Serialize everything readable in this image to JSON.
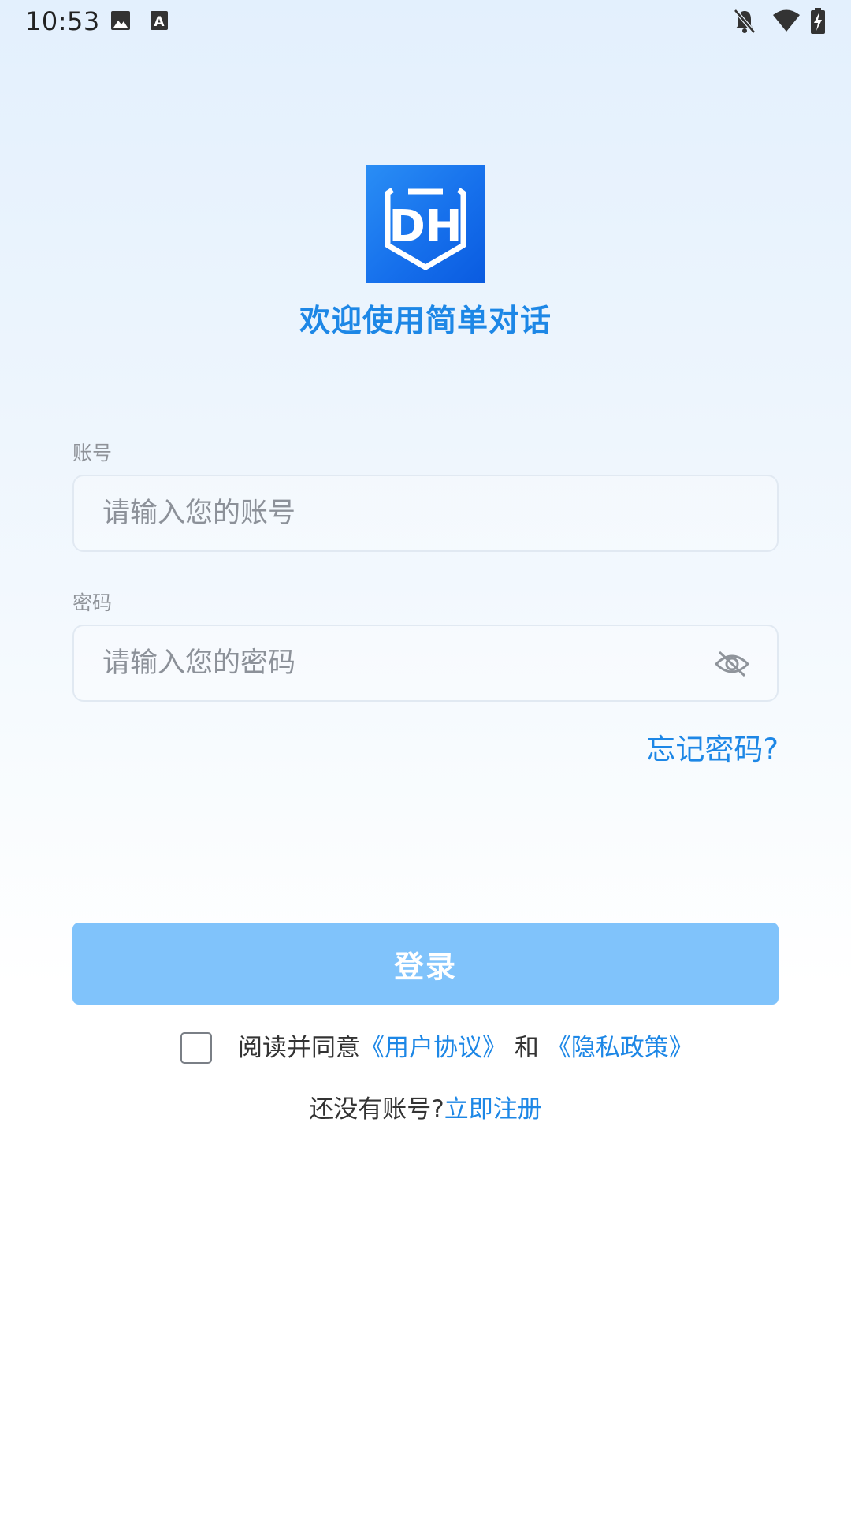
{
  "status_bar": {
    "time": "10:53",
    "left_icons": [
      "image-icon",
      "a-icon"
    ],
    "right_icons": [
      "bell-off-icon",
      "wifi-icon",
      "battery-charging-icon"
    ]
  },
  "app": {
    "logo_text": "DH",
    "welcome": "欢迎使用简单对话",
    "accent_color": "#1d87e6",
    "logo_color": "#1670ec"
  },
  "form": {
    "account_label": "账号",
    "account_placeholder": "请输入您的账号",
    "account_value": "",
    "password_label": "密码",
    "password_placeholder": "请输入您的密码",
    "password_value": "",
    "password_toggle_icon": "eye-off-icon",
    "forgot": "忘记密码?"
  },
  "login_button": {
    "label": "登录",
    "color": "#80c3fb"
  },
  "agreement": {
    "checked": false,
    "prefix": "阅读并同意",
    "user_agreement": "《用户协议》",
    "and": " 和 ",
    "privacy_policy": "《隐私政策》"
  },
  "register": {
    "prompt": "还没有账号?",
    "link": "立即注册"
  }
}
